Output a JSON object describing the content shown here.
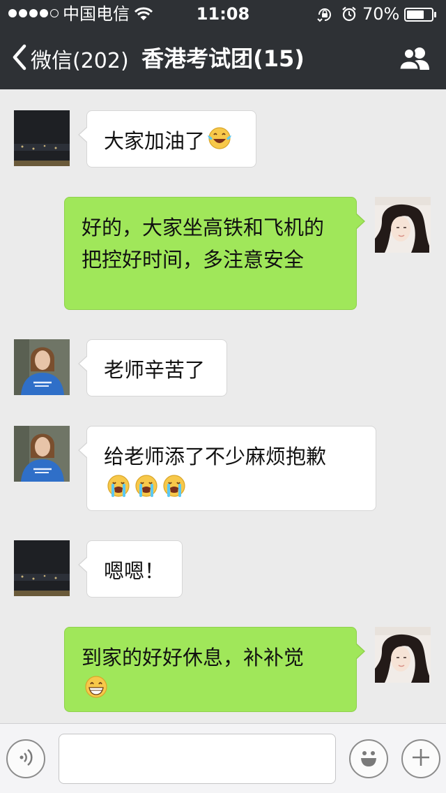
{
  "status_bar": {
    "carrier": "中国电信",
    "time": "11:08",
    "battery_percent": "70%",
    "battery_level": 0.7,
    "signal_bars_filled": 4,
    "signal_bars_total": 5
  },
  "nav": {
    "back_label": "微信(202)",
    "title": "香港考试团(15)",
    "back_icon": "chevron-left-icon",
    "group_icon": "group-members-icon"
  },
  "messages": [
    {
      "side": "left",
      "avatar": "avatar-night-city",
      "text": "大家加油了",
      "emojis": [
        "tears-of-joy"
      ]
    },
    {
      "side": "right",
      "avatar": "avatar-woman-self",
      "text": "好的，大家坐高铁和飞机的把控好时间，多注意安全",
      "emojis": []
    },
    {
      "side": "left",
      "avatar": "avatar-girl-blue-sweater",
      "text": "老师辛苦了",
      "emojis": []
    },
    {
      "side": "left",
      "avatar": "avatar-girl-blue-sweater",
      "text": "给老师添了不少麻烦抱歉",
      "emojis": [
        "loudly-crying",
        "loudly-crying",
        "loudly-crying"
      ]
    },
    {
      "side": "left",
      "avatar": "avatar-night-city",
      "text": "嗯嗯！",
      "emojis": []
    },
    {
      "side": "right",
      "avatar": "avatar-woman-self",
      "text": "到家的好好休息，补补觉",
      "emojis": [
        "grinning"
      ]
    }
  ],
  "toolbar": {
    "voice_icon": "voice-input-icon",
    "emoji_icon": "emoji-smile-icon",
    "plus_icon": "plus-icon",
    "input_value": ""
  },
  "colors": {
    "header_bg": "#2e3135",
    "chat_bg": "#ebebeb",
    "my_bubble": "#a0e75a",
    "their_bubble": "#ffffff"
  }
}
